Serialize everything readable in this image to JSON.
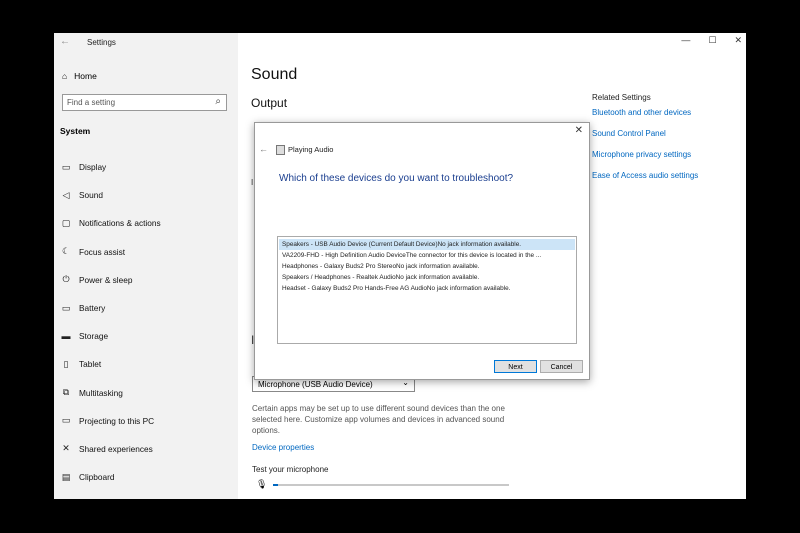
{
  "window": {
    "title": "Settings"
  },
  "sidebar": {
    "home": "Home",
    "search_placeholder": "Find a setting",
    "section": "System",
    "items": [
      {
        "label": "Display",
        "icon": "monitor-icon"
      },
      {
        "label": "Sound",
        "icon": "speaker-icon"
      },
      {
        "label": "Notifications & actions",
        "icon": "notification-icon"
      },
      {
        "label": "Focus assist",
        "icon": "moon-icon"
      },
      {
        "label": "Power & sleep",
        "icon": "power-icon"
      },
      {
        "label": "Battery",
        "icon": "battery-icon"
      },
      {
        "label": "Storage",
        "icon": "storage-icon"
      },
      {
        "label": "Tablet",
        "icon": "tablet-icon"
      },
      {
        "label": "Multitasking",
        "icon": "multitasking-icon"
      },
      {
        "label": "Projecting to this PC",
        "icon": "projector-icon"
      },
      {
        "label": "Shared experiences",
        "icon": "share-icon"
      },
      {
        "label": "Clipboard",
        "icon": "clipboard-icon"
      }
    ]
  },
  "main": {
    "title": "Sound",
    "output_heading": "Output",
    "input_device": "Microphone (USB Audio Device)",
    "input_description": "Certain apps may be set up to use different sound devices than the one selected here. Customize app volumes and devices in advanced sound options.",
    "device_properties": "Device properties",
    "test_mic": "Test your microphone",
    "mic_level": 0.02
  },
  "related": {
    "title": "Related Settings",
    "links": [
      "Bluetooth and other devices",
      "Sound Control Panel",
      "Microphone privacy settings",
      "Ease of Access audio settings"
    ]
  },
  "dialog": {
    "title": "Playing Audio",
    "question": "Which of these devices do you want to troubleshoot?",
    "devices": [
      "Speakers - USB Audio Device (Current Default Device)No jack information available.",
      "VA2209-FHD - High Definition Audio DeviceThe connector for this device is located in the ...",
      "Headphones - Galaxy Buds2 Pro StereoNo jack information available.",
      "Speakers / Headphones - Realtek AudioNo jack information available.",
      "Headset - Galaxy Buds2 Pro Hands-Free AG AudioNo jack information available."
    ],
    "selected_index": 0,
    "next": "Next",
    "cancel": "Cancel"
  },
  "colors": {
    "accent": "#0067c0",
    "sidebar_bg": "#f2f2f2",
    "selection": "#cce4f7"
  }
}
